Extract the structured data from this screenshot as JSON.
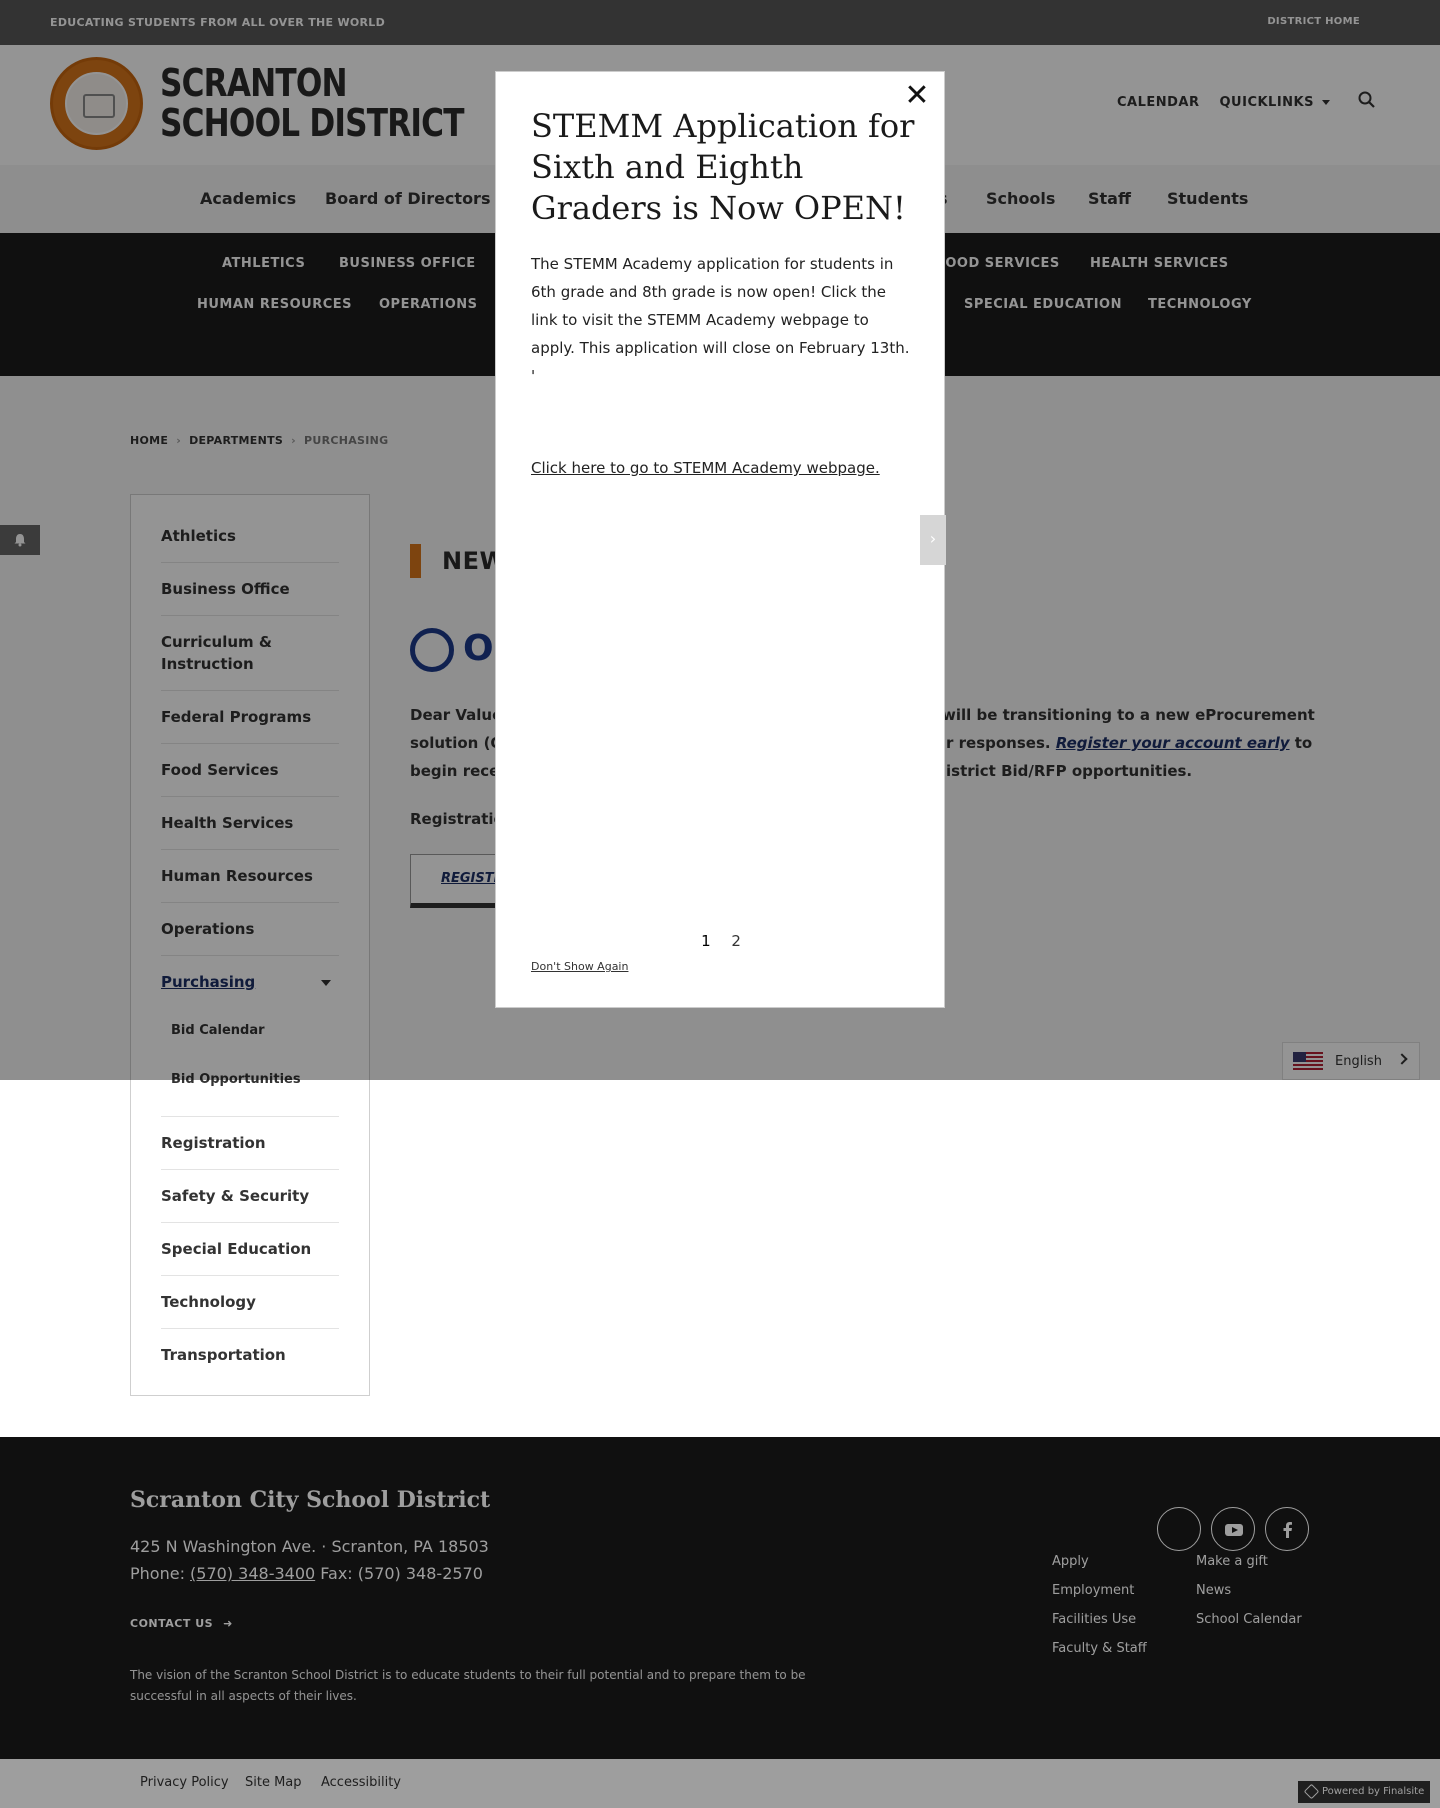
{
  "topbar": {
    "tagline": "EDUCATING STUDENTS FROM ALL OVER THE WORLD",
    "district_home": "DISTRICT HOME"
  },
  "header": {
    "logo_line1": "SCRANTON",
    "logo_line2": "SCHOOL DISTRICT",
    "calendar": "CALENDAR",
    "quicklinks": "QUICKLINKS"
  },
  "mainnav": {
    "items": [
      "Academics",
      "Board of Directors",
      "Schools",
      "Staff",
      "Students"
    ],
    "partial": "s"
  },
  "subnav": {
    "row1": [
      "ATHLETICS",
      "BUSINESS OFFICE",
      "FOOD SERVICES",
      "HEALTH SERVICES"
    ],
    "row2": [
      "HUMAN RESOURCES",
      "OPERATIONS",
      "SPECIAL EDUCATION",
      "TECHNOLOGY"
    ]
  },
  "breadcrumb": {
    "home": "HOME",
    "departments": "DEPARTMENTS",
    "current": "PURCHASING"
  },
  "sidebar": {
    "items": [
      "Athletics",
      "Business Office",
      "Curriculum &",
      "Instruction",
      "Federal Programs",
      "Food Services",
      "Health Services",
      "Human Resources",
      "Operations",
      "Purchasing"
    ],
    "sub_items": [
      "Bid Calendar",
      "Bid Opportunities"
    ],
    "lower_items": [
      "Registration",
      "Safety & Security",
      "Special Education",
      "Technology",
      "Transportation"
    ]
  },
  "article": {
    "title_fragment": "NEW",
    "brand_fragment": "OP",
    "line1_left": "Dear Value",
    "line1_right": "will be transitioning to a new eProcurement",
    "line2_left": "solution (O",
    "line2_mid": "r responses.",
    "line2_link": "Register your account early",
    "line2_right": "to",
    "line3_left": "begin recei",
    "line3_right": "istrict Bid/RFP opportunities.",
    "line4_left": "Registratio",
    "button_fragment": "REGISTE"
  },
  "language": {
    "label": "English"
  },
  "modal": {
    "title": "STEMM Application for Sixth and Eighth Graders is Now OPEN!",
    "body": "The STEMM Academy application for students in 6th grade and 8th grade is now open! Click the link to visit the STEMM Academy webpage to apply. This application will close on February 13th. '",
    "link": "Click here to go to STEMM Academy webpage.",
    "close": "✕",
    "next": "›",
    "pages": [
      "1",
      "2"
    ],
    "dont_show": "Don't Show Again"
  },
  "footer": {
    "district": "Scranton City School District",
    "address": "425 N Washington Ave.  · Scranton, PA  18503",
    "phone_label": "Phone:",
    "phone": "(570) 348-3400",
    "fax": "Fax: (570) 348-2570",
    "contact": "CONTACT US",
    "vision": "The vision of the Scranton School District is to educate students to their full potential and to prepare them to be successful in all aspects of their lives.",
    "links_col1": [
      "Apply",
      "Employment",
      "Facilities Use",
      "Faculty & Staff"
    ],
    "links_col2": [
      "Make a gift",
      "News",
      "School Calendar"
    ]
  },
  "bottombar": {
    "links": [
      "Privacy Policy",
      "Site Map",
      "Accessibility"
    ],
    "powered": "Powered by Finalsite"
  },
  "colors": {
    "accent_orange": "#d8751a",
    "navy": "#1d2f66",
    "footer_bg": "#1a1a1a"
  }
}
